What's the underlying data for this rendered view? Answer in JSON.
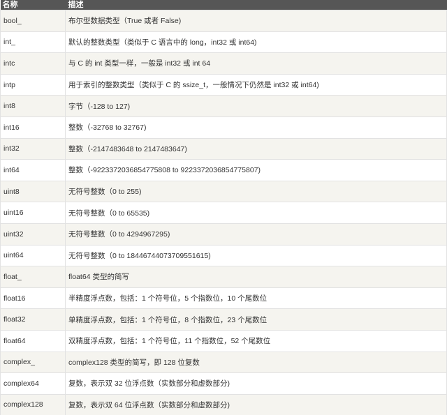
{
  "headers": [
    "名称",
    "描述"
  ],
  "rows": [
    [
      "bool_",
      "布尔型数据类型（True 或者 False)"
    ],
    [
      "int_",
      "默认的整数类型（类似于 C 语言中的 long，int32 或 int64)"
    ],
    [
      "intc",
      "与 C 的 int 类型一样，一般是 int32 或 int 64"
    ],
    [
      "intp",
      "用于索引的整数类型（类似于 C 的 ssize_t，一般情况下仍然是 int32 或 int64)"
    ],
    [
      "int8",
      "字节（-128 to 127)"
    ],
    [
      "int16",
      "整数（-32768 to 32767)"
    ],
    [
      "int32",
      "整数（-2147483648 to 2147483647)"
    ],
    [
      "int64",
      "整数（-9223372036854775808 to 9223372036854775807)"
    ],
    [
      "uint8",
      "无符号整数（0 to 255)"
    ],
    [
      "uint16",
      "无符号整数（0 to 65535)"
    ],
    [
      "uint32",
      "无符号整数（0 to 4294967295)"
    ],
    [
      "uint64",
      "无符号整数（0 to 18446744073709551615)"
    ],
    [
      "float_",
      "float64 类型的简写"
    ],
    [
      "float16",
      "半精度浮点数，包括：1 个符号位，5 个指数位，10 个尾数位"
    ],
    [
      "float32",
      "单精度浮点数，包括：1 个符号位，8 个指数位，23 个尾数位"
    ],
    [
      "float64",
      "双精度浮点数，包括：1 个符号位，11 个指数位，52 个尾数位"
    ],
    [
      "complex_",
      "complex128 类型的简写，即 128 位复数"
    ],
    [
      "complex64",
      "复数，表示双 32 位浮点数（实数部分和虚数部分)"
    ],
    [
      "complex128",
      "复数，表示双 64 位浮点数（实数部分和虚数部分)"
    ]
  ]
}
